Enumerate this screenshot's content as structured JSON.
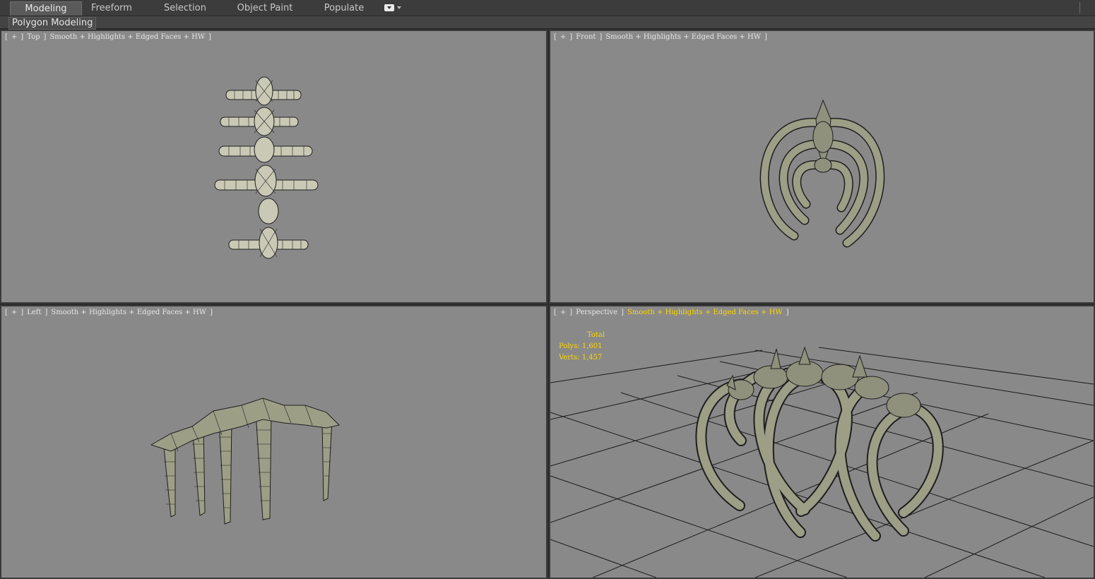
{
  "ribbon": {
    "tabs": [
      "Modeling",
      "Freeform",
      "Selection",
      "Object Paint",
      "Populate"
    ],
    "active_tab": "Modeling",
    "panel_label": "Polygon Modeling"
  },
  "viewports": {
    "top": {
      "bracket_open": "[",
      "plus": "+",
      "sep1": "]",
      "name": "Top",
      "sep2": "]",
      "shading": "Smooth + Highlights + Edged Faces + HW",
      "bracket_close": "]"
    },
    "front": {
      "bracket_open": "[",
      "plus": "+",
      "sep1": "]",
      "name": "Front",
      "sep2": "]",
      "shading": "Smooth + Highlights + Edged Faces + HW",
      "bracket_close": "]"
    },
    "left": {
      "bracket_open": "[",
      "plus": "+",
      "sep1": "]",
      "name": "Left",
      "sep2": "]",
      "shading": "Smooth + Highlights + Edged Faces + HW",
      "bracket_close": "]"
    },
    "perspective": {
      "bracket_open": "[",
      "plus": "+",
      "sep1": "]",
      "name": "Perspective",
      "sep2": "]",
      "shading": "Smooth + Highlights + Edged Faces + HW",
      "bracket_close": "]"
    }
  },
  "stats": {
    "header": "Total",
    "polys_label": "Polys:",
    "polys_value": "1,601",
    "verts_label": "Verts:",
    "verts_value": "1,457"
  },
  "colors": {
    "viewport_bg": "#898989",
    "mesh_fill": "#9c9e86",
    "mesh_edge": "#1e1e1e",
    "active_label": "#ffd700"
  }
}
